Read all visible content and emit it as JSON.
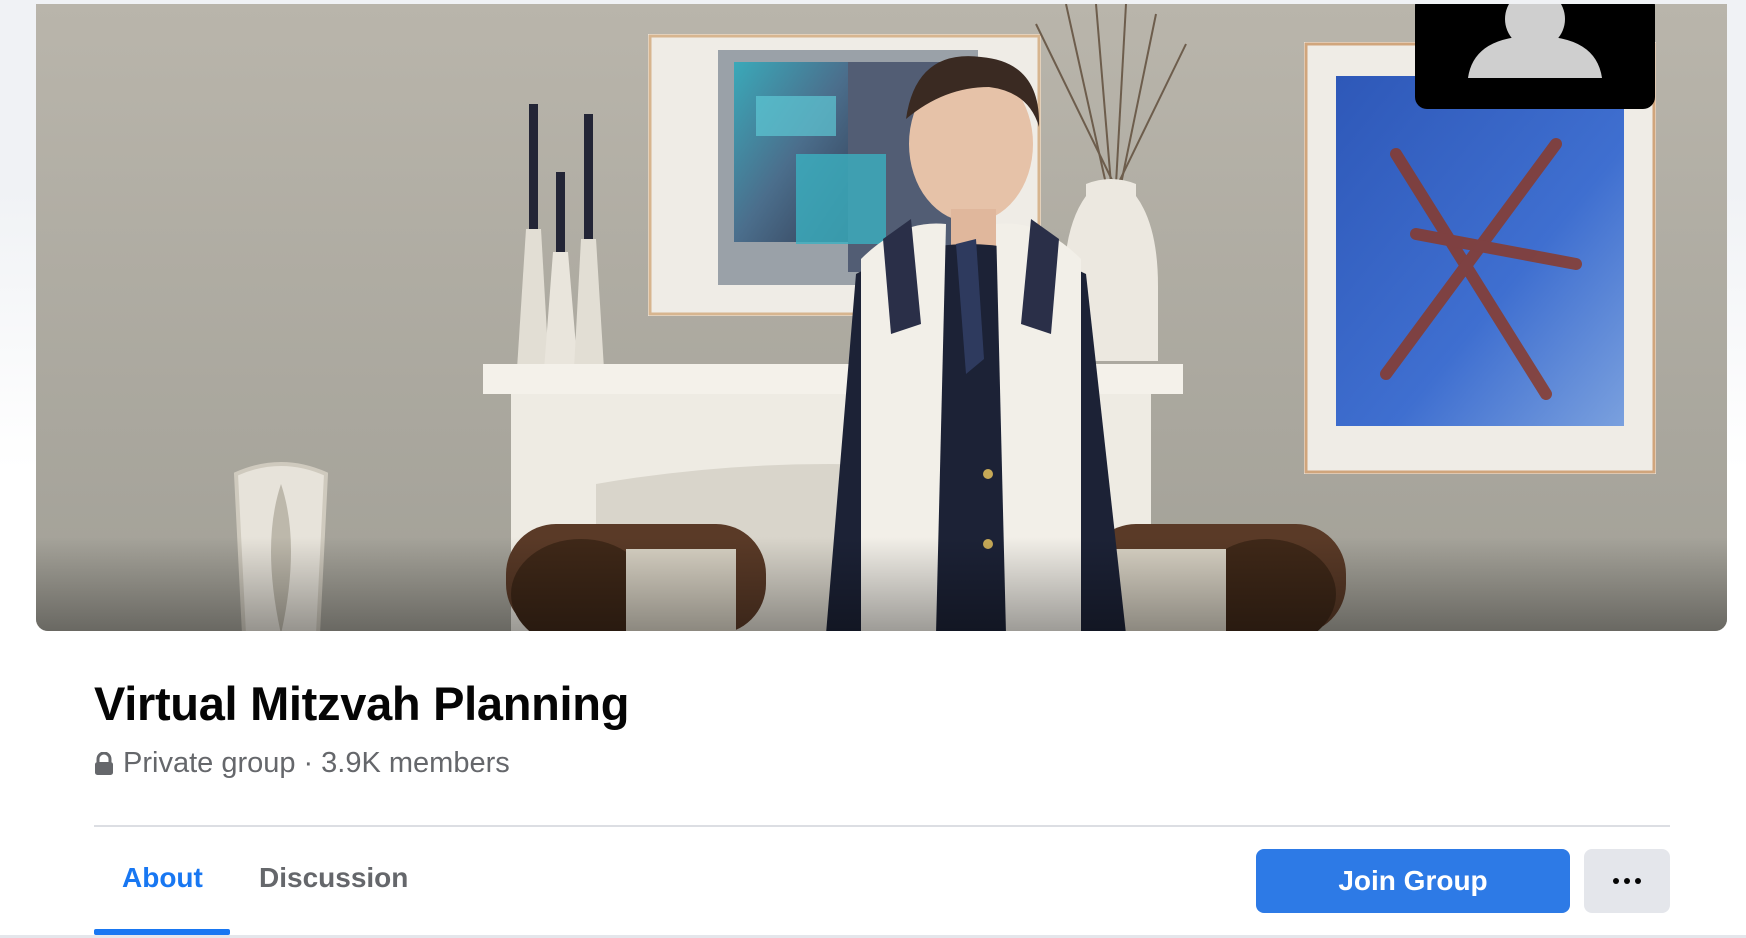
{
  "group": {
    "title": "Virtual Mitzvah Planning",
    "privacy": "Private group",
    "separator": "·",
    "members": "3.9K members"
  },
  "tabs": [
    {
      "label": "About",
      "active": true
    },
    {
      "label": "Discussion",
      "active": false
    }
  ],
  "actions": {
    "join_label": "Join Group",
    "more_icon": "ellipsis-icon"
  },
  "colors": {
    "accent": "#1877f2",
    "join_button": "#2d7ae6",
    "secondary_button": "#e4e6eb",
    "muted_text": "#65676b"
  }
}
